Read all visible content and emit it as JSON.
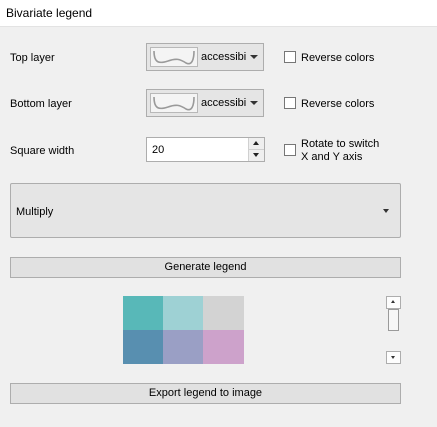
{
  "window": {
    "title": "Bivariate legend"
  },
  "top_layer": {
    "label": "Top layer",
    "combo_text": "accessibi",
    "reverse_label": "Reverse colors",
    "reverse_checked": false
  },
  "bottom_layer": {
    "label": "Bottom layer",
    "combo_text": "accessibi",
    "reverse_label": "Reverse colors",
    "reverse_checked": false
  },
  "square_width": {
    "label": "Square width",
    "value": "20",
    "rotate_label_line1": "Rotate to switch",
    "rotate_label_line2": "X and Y axis",
    "rotate_checked": false
  },
  "blend_mode": {
    "selected": "Multiply"
  },
  "buttons": {
    "generate": "Generate legend",
    "export": "Export legend to image"
  },
  "legend": {
    "colors": [
      [
        "#58b8b8",
        "#9ed1d4",
        "#d3d3d3"
      ],
      [
        "#588fb0",
        "#9a9fc5",
        "#cda2cb"
      ]
    ]
  },
  "icons": {
    "combo_preview": "ramp-preview-icon",
    "combo_arrow": "chevron-down-icon",
    "spin_up": "arrow-up-icon",
    "spin_down": "arrow-down-icon"
  }
}
